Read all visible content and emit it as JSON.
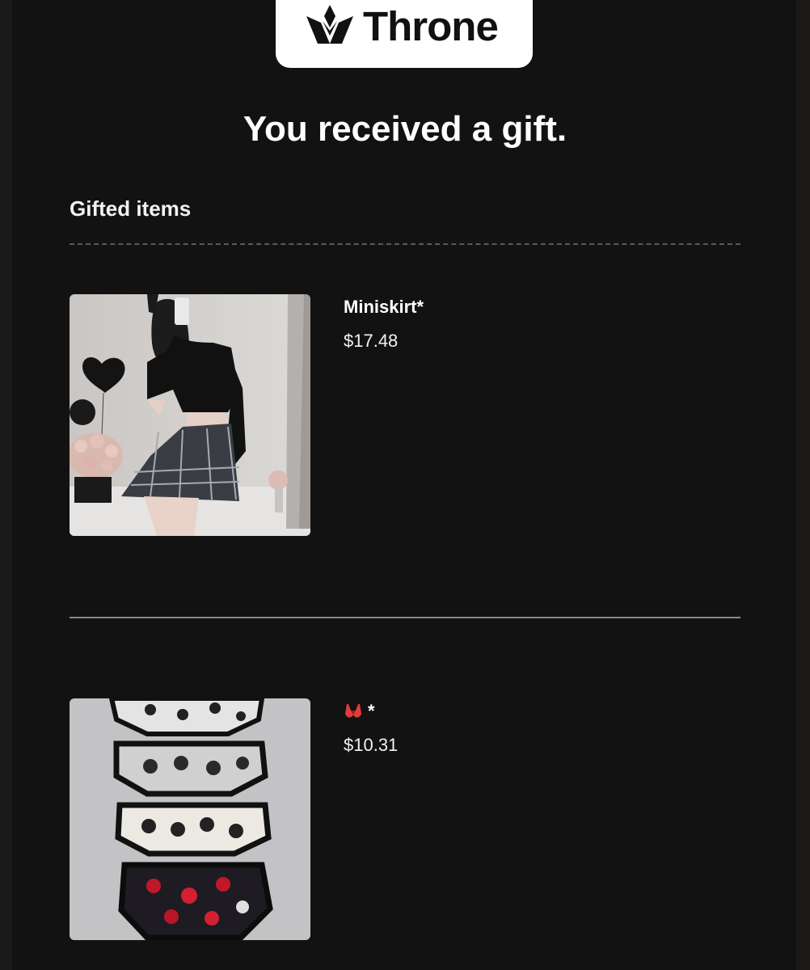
{
  "brand": {
    "name": "Throne"
  },
  "email": {
    "headline": "You received a gift.",
    "section_title": "Gifted items"
  },
  "items": [
    {
      "name": "Miniskirt*",
      "price": "$17.48",
      "image_icon": "product-photo-miniskirt"
    },
    {
      "name": "*",
      "name_icon": "bra-emoji-icon",
      "price": "$10.31",
      "image_icon": "product-photo-underwear"
    }
  ],
  "colors": {
    "background": "#121212",
    "text": "#ffffff",
    "logo_card": "#ffffff"
  }
}
